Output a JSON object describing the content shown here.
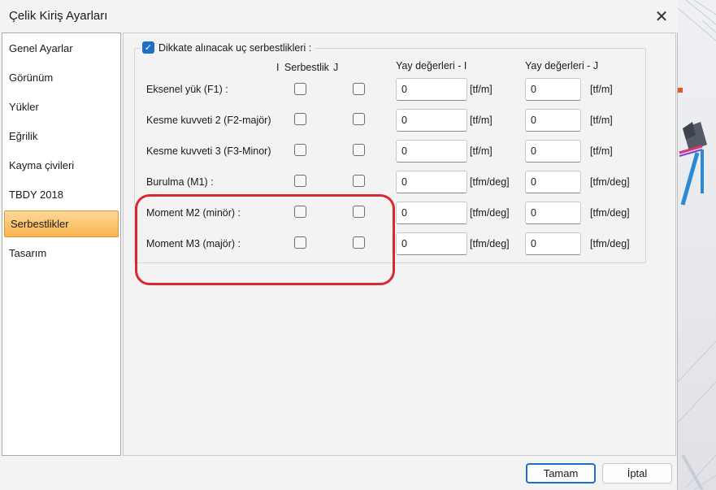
{
  "window": {
    "title": "Çelik Kiriş Ayarları",
    "close_glyph": "✕"
  },
  "nav": {
    "items": [
      {
        "label": "Genel Ayarlar",
        "active": false
      },
      {
        "label": "Görünüm",
        "active": false
      },
      {
        "label": "Yükler",
        "active": false
      },
      {
        "label": "Eğrilik",
        "active": false
      },
      {
        "label": "Kayma çivileri",
        "active": false
      },
      {
        "label": "TBDY 2018",
        "active": false
      },
      {
        "label": "Serbestlikler",
        "active": true
      },
      {
        "label": "Tasarım",
        "active": false
      }
    ]
  },
  "releases": {
    "enable_checkbox": {
      "label": "Dikkate alınacak uç serbestlikleri :",
      "checked": true
    },
    "headers": {
      "i": "I",
      "release": "Serbestlik",
      "j": "J",
      "spring_i": "Yay değerleri - I",
      "spring_j": "Yay değerleri - J"
    },
    "rows": [
      {
        "label": "Eksenel yük (F1) :",
        "release_i": false,
        "release_j": false,
        "spring_i": "0",
        "unit_i": "[tf/m]",
        "spring_j": "0",
        "unit_j": "[tf/m]"
      },
      {
        "label": "Kesme kuvveti 2 (F2-majör)",
        "release_i": false,
        "release_j": false,
        "spring_i": "0",
        "unit_i": "[tf/m]",
        "spring_j": "0",
        "unit_j": "[tf/m]"
      },
      {
        "label": "Kesme kuvveti 3 (F3-Minor)",
        "release_i": false,
        "release_j": false,
        "spring_i": "0",
        "unit_i": "[tf/m]",
        "spring_j": "0",
        "unit_j": "[tf/m]"
      },
      {
        "label": "Burulma (M1) :",
        "release_i": false,
        "release_j": false,
        "spring_i": "0",
        "unit_i": "[tfm/deg]",
        "spring_j": "0",
        "unit_j": "[tfm/deg]"
      },
      {
        "label": "Moment M2 (minör) :",
        "release_i": false,
        "release_j": false,
        "spring_i": "0",
        "unit_i": "[tfm/deg]",
        "spring_j": "0",
        "unit_j": "[tfm/deg]"
      },
      {
        "label": "Moment M3 (majör) :",
        "release_i": false,
        "release_j": false,
        "spring_i": "0",
        "unit_i": "[tfm/deg]",
        "spring_j": "0",
        "unit_j": "[tfm/deg]"
      }
    ]
  },
  "buttons": {
    "ok": "Tamam",
    "cancel": "İptal"
  },
  "colors": {
    "accent": "#1f6fc6",
    "highlight": "#d9282f",
    "active_nav": "#fbc46e"
  }
}
